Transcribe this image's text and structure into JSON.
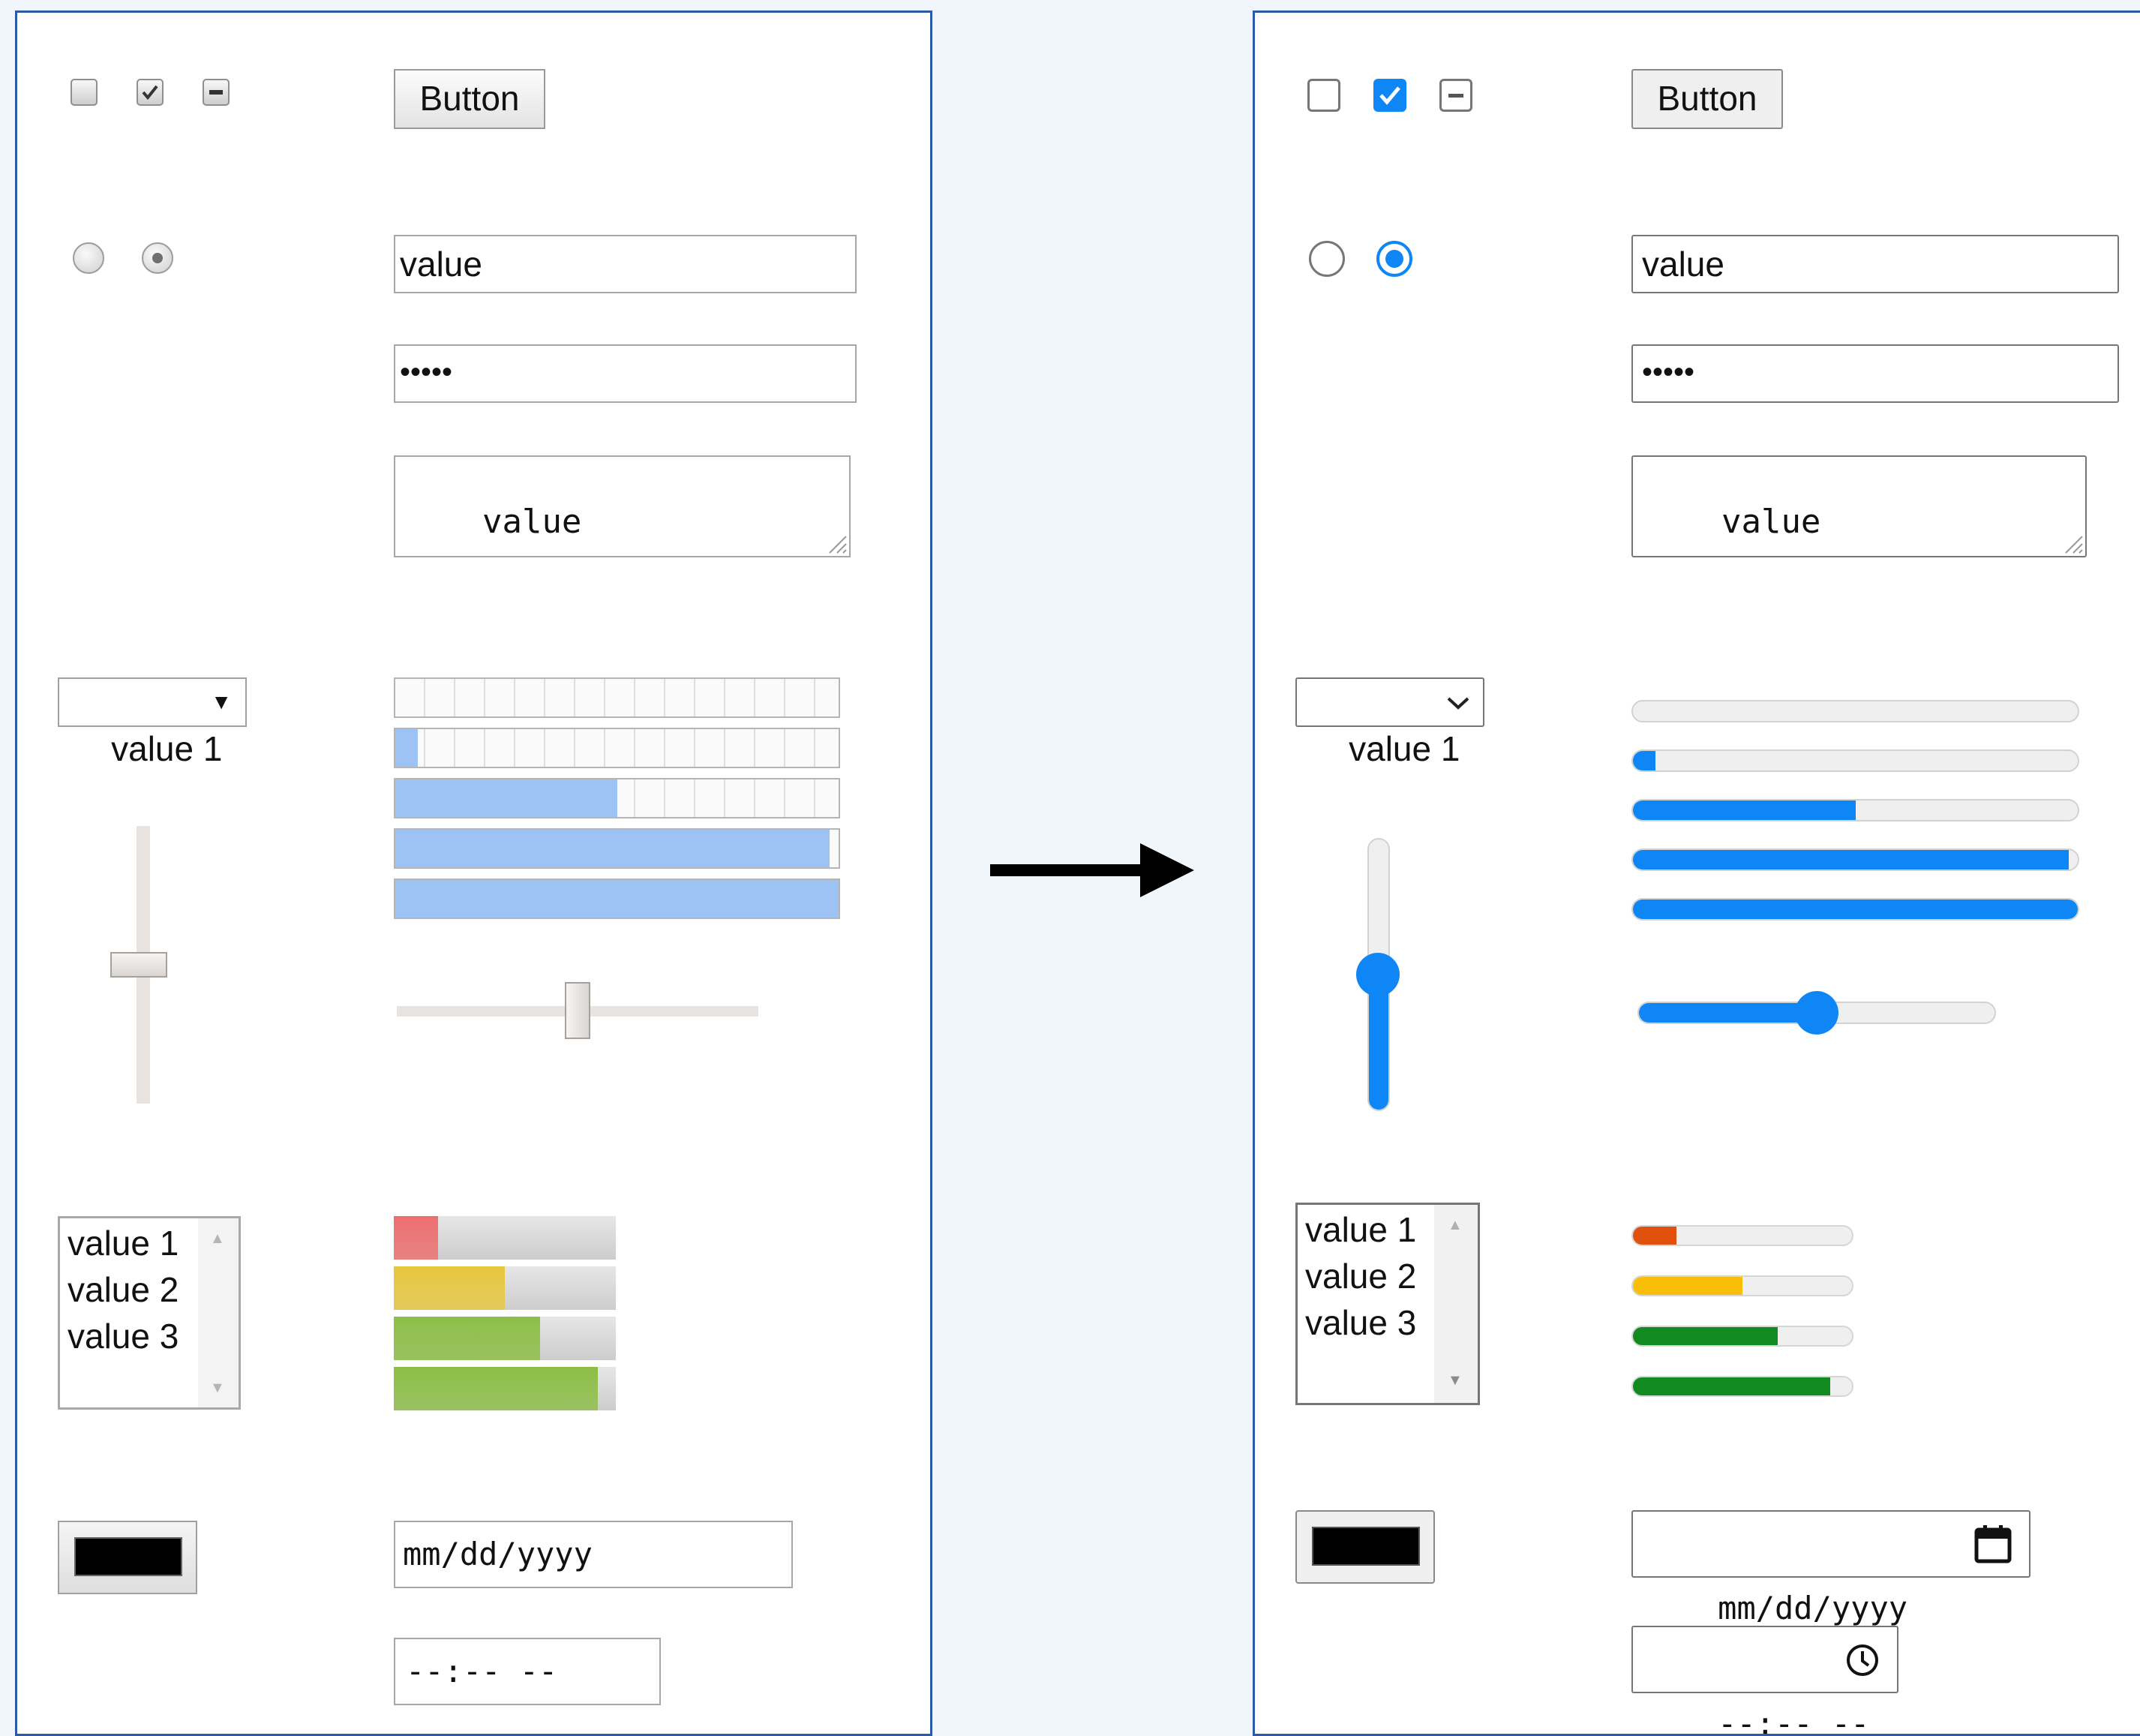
{
  "legacy": {
    "button_label": "Button",
    "text_value": "value",
    "password_mask": "•••••",
    "textarea_value": "value",
    "select_value": "value 1",
    "select_arrow": "▼",
    "listbox_options": [
      "value 1",
      "value 2",
      "value 3"
    ],
    "scroll_up": "▲",
    "scroll_down": "▼",
    "progress_values": [
      0,
      0.05,
      0.5,
      0.98,
      1
    ],
    "vertical_slider_value": 0.5,
    "horizontal_slider_value": 0.5,
    "meter_values": [
      0.2,
      0.5,
      0.66,
      0.92
    ],
    "meter_colors": [
      "#ec6f6f",
      "#e7c63e",
      "#8cbe46",
      "#8cbe46"
    ],
    "color_value": "#000000",
    "date_placeholder": "mm/dd/yyyy",
    "time_placeholder": "--:-- --"
  },
  "modern": {
    "button_label": "Button",
    "text_value": "value",
    "password_mask": "•••••",
    "textarea_value": "value",
    "select_value": "value 1",
    "listbox_options": [
      "value 1",
      "value 2",
      "value 3"
    ],
    "scroll_up": "▲",
    "scroll_down": "▼",
    "progress_values": [
      0,
      0.05,
      0.5,
      0.98,
      1
    ],
    "vertical_slider_value": 0.5,
    "horizontal_slider_value": 0.5,
    "meter_values": [
      0.2,
      0.5,
      0.66,
      0.9
    ],
    "meter_colors": [
      "#e0510d",
      "#f9be08",
      "#118b20",
      "#118b20"
    ],
    "accent_color": "#0f86f5",
    "color_value": "#000000",
    "date_placeholder": "mm/dd/yyyy",
    "time_placeholder": "--:-- --"
  }
}
